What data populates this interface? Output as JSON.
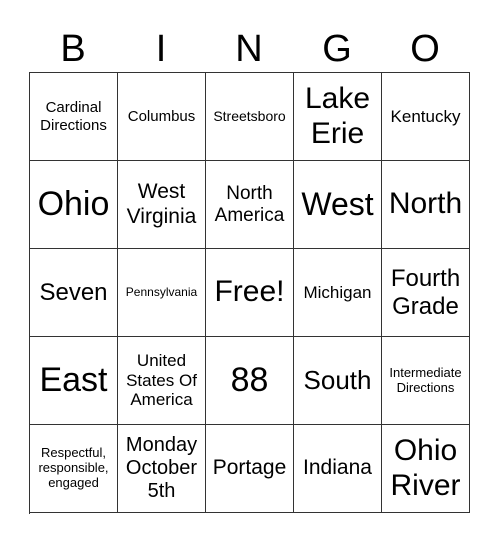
{
  "header": [
    "B",
    "I",
    "N",
    "G",
    "O"
  ],
  "cells": [
    "Cardinal Directions",
    "Columbus",
    "Streetsboro",
    "Lake Erie",
    "Kentucky",
    "Ohio",
    "West Virginia",
    "North America",
    "West",
    "North",
    "Seven",
    "Pennsylvania",
    "Free!",
    "Michigan",
    "Fourth Grade",
    "East",
    "United States Of America",
    "88",
    "South",
    "Intermediate Directions",
    "Respectful, responsible, engaged",
    "Monday October 5th",
    "Portage",
    "Indiana",
    "Ohio River"
  ]
}
